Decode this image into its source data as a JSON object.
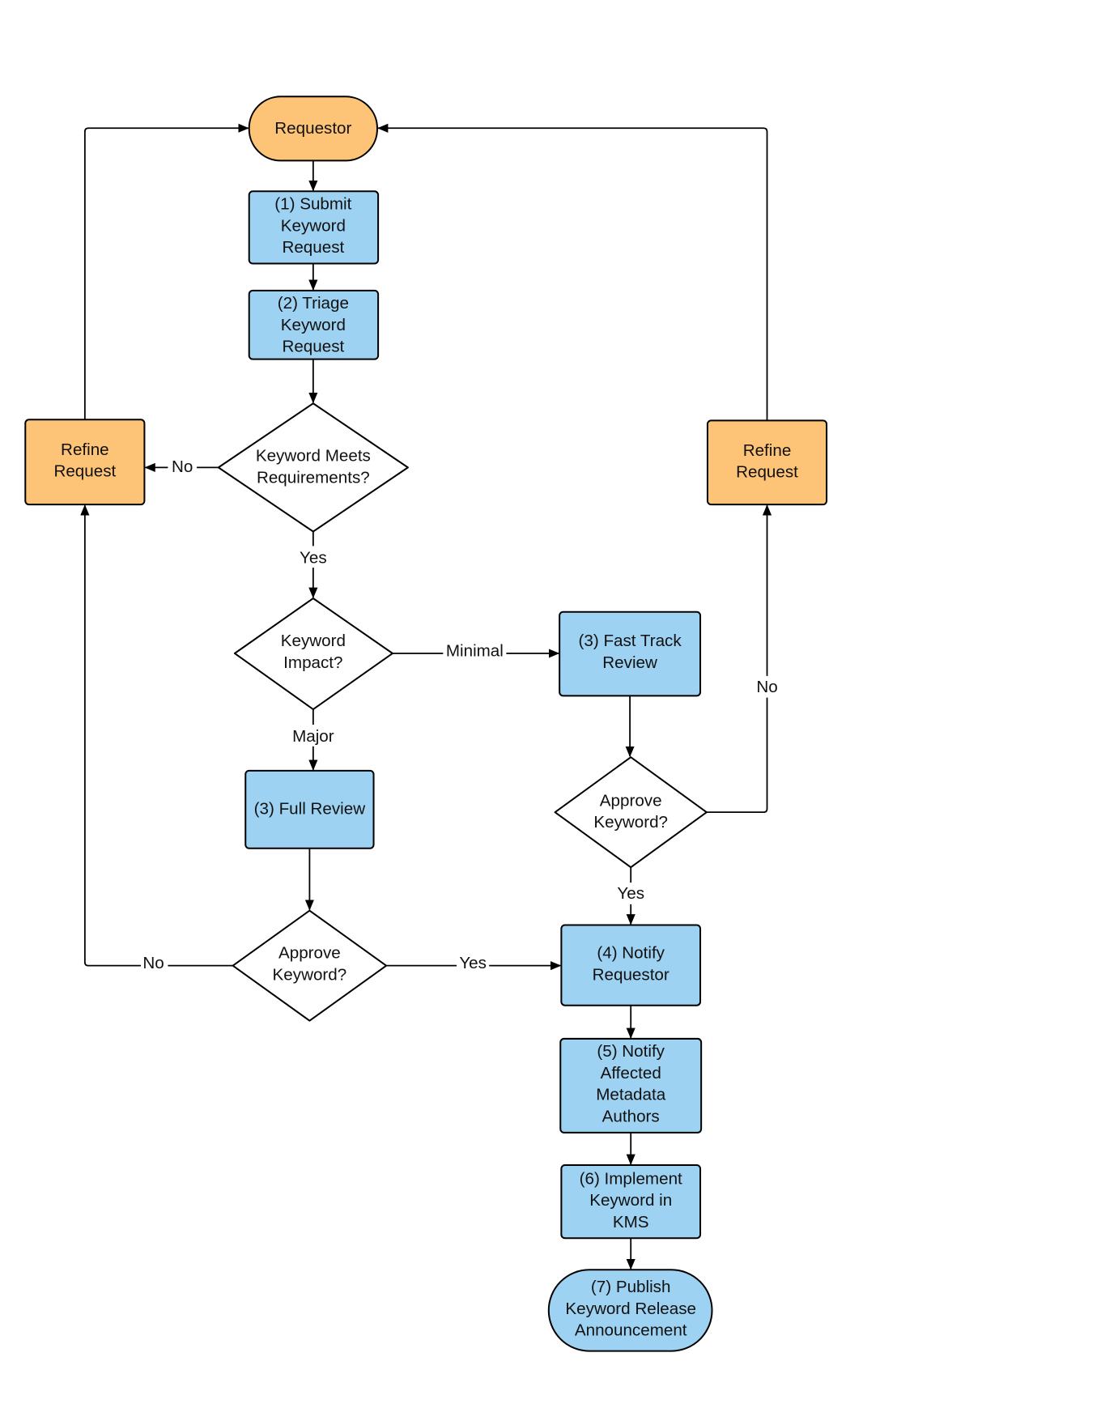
{
  "colors": {
    "start_end_orange": "#FDC477",
    "process_blue": "#9DD2F2",
    "decision_white": "#FFFFFF",
    "line": "#000000"
  },
  "nodes": {
    "requestor": [
      "Requestor"
    ],
    "submit": [
      "(1) Submit",
      "Keyword",
      "Request"
    ],
    "triage": [
      "(2) Triage",
      "Keyword",
      "Request"
    ],
    "meets_requirements": [
      "Keyword Meets",
      "Requirements?"
    ],
    "refine_left": [
      "Refine",
      "Request"
    ],
    "refine_right": [
      "Refine",
      "Request"
    ],
    "impact": [
      "Keyword",
      "Impact?"
    ],
    "fast_track": [
      "(3) Fast Track",
      "Review"
    ],
    "full_review": [
      "(3) Full Review"
    ],
    "approve_fast": [
      "Approve",
      "Keyword?"
    ],
    "approve_full": [
      "Approve",
      "Keyword?"
    ],
    "notify_requestor": [
      "(4) Notify",
      "Requestor"
    ],
    "notify_authors": [
      "(5) Notify",
      "Affected",
      "Metadata",
      "Authors"
    ],
    "implement": [
      "(6) Implement",
      "Keyword in",
      "KMS"
    ],
    "publish": [
      "(7) Publish",
      "Keyword Release",
      "Announcement"
    ]
  },
  "edge_labels": {
    "req_no": "No",
    "req_yes": "Yes",
    "impact_minimal": "Minimal",
    "impact_major": "Major",
    "fast_no": "No",
    "fast_yes": "Yes",
    "full_no": "No",
    "full_yes": "Yes"
  }
}
